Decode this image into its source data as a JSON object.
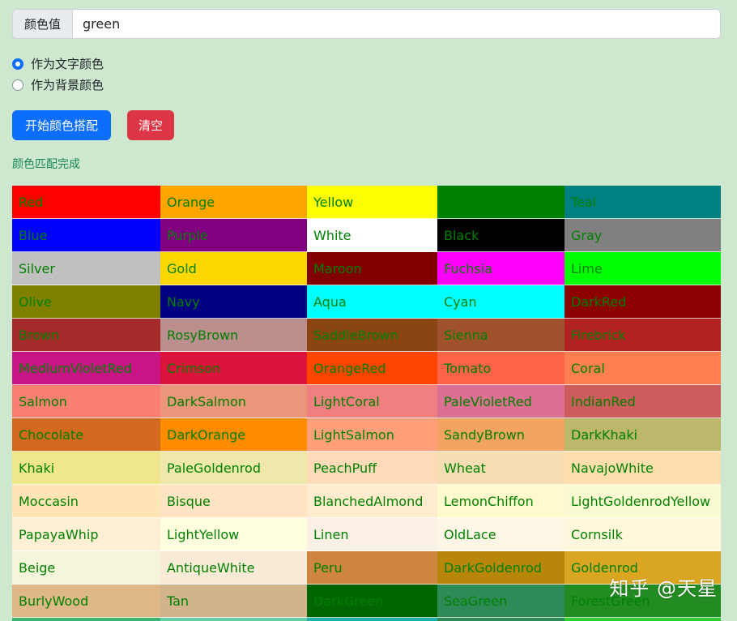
{
  "form": {
    "addon_label": "颜色值",
    "input_value": "green",
    "radio_text_color_label": "作为文字颜色",
    "radio_bg_color_label": "作为背景颜色",
    "selected_option": "作为文字颜色",
    "start_button": "开始颜色搭配",
    "clear_button": "清空",
    "status": "颜色匹配完成"
  },
  "colors": {
    "primary": "#0d6efd",
    "danger": "#dc3545",
    "success_text": "#198754",
    "cell_text": "#008000",
    "page_bg": "#cde8cf"
  },
  "swatches": [
    {
      "name": "Red",
      "bg": "#ff0000"
    },
    {
      "name": "Orange",
      "bg": "#ffa500"
    },
    {
      "name": "Yellow",
      "bg": "#ffff00"
    },
    {
      "name": "",
      "bg": "#008000"
    },
    {
      "name": "Teal",
      "bg": "#008080"
    },
    {
      "name": "Blue",
      "bg": "#0000ff"
    },
    {
      "name": "Purple",
      "bg": "#800080"
    },
    {
      "name": "White",
      "bg": "#ffffff"
    },
    {
      "name": "Black",
      "bg": "#000000"
    },
    {
      "name": "Gray",
      "bg": "#808080"
    },
    {
      "name": "Silver",
      "bg": "#c0c0c0"
    },
    {
      "name": "Gold",
      "bg": "#ffd700"
    },
    {
      "name": "Maroon",
      "bg": "#800000"
    },
    {
      "name": "Fuchsia",
      "bg": "#ff00ff"
    },
    {
      "name": "Lime",
      "bg": "#00ff00"
    },
    {
      "name": "Olive",
      "bg": "#808000"
    },
    {
      "name": "Navy",
      "bg": "#000080"
    },
    {
      "name": "Aqua",
      "bg": "#00ffff"
    },
    {
      "name": "Cyan",
      "bg": "#00ffff"
    },
    {
      "name": "DarkRed",
      "bg": "#8b0000"
    },
    {
      "name": "Brown",
      "bg": "#a52a2a"
    },
    {
      "name": "RosyBrown",
      "bg": "#bc8f8f"
    },
    {
      "name": "SaddleBrown",
      "bg": "#8b4513"
    },
    {
      "name": "Sienna",
      "bg": "#a0522d"
    },
    {
      "name": "Firebrick",
      "bg": "#b22222"
    },
    {
      "name": "MediumVioletRed",
      "bg": "#c71585"
    },
    {
      "name": "Crimson",
      "bg": "#dc143c"
    },
    {
      "name": "OrangeRed",
      "bg": "#ff4500"
    },
    {
      "name": "Tomato",
      "bg": "#ff6347"
    },
    {
      "name": "Coral",
      "bg": "#ff7f50"
    },
    {
      "name": "Salmon",
      "bg": "#fa8072"
    },
    {
      "name": "DarkSalmon",
      "bg": "#e9967a"
    },
    {
      "name": "LightCoral",
      "bg": "#f08080"
    },
    {
      "name": "PaleVioletRed",
      "bg": "#db7093"
    },
    {
      "name": "IndianRed",
      "bg": "#cd5c5c"
    },
    {
      "name": "Chocolate",
      "bg": "#d2691e"
    },
    {
      "name": "DarkOrange",
      "bg": "#ff8c00"
    },
    {
      "name": "LightSalmon",
      "bg": "#ffa07a"
    },
    {
      "name": "SandyBrown",
      "bg": "#f4a460"
    },
    {
      "name": "DarkKhaki",
      "bg": "#bdb76b"
    },
    {
      "name": "Khaki",
      "bg": "#f0e68c"
    },
    {
      "name": "PaleGoldenrod",
      "bg": "#eee8aa"
    },
    {
      "name": "PeachPuff",
      "bg": "#ffdab9"
    },
    {
      "name": "Wheat",
      "bg": "#f5deb3"
    },
    {
      "name": "NavajoWhite",
      "bg": "#ffdead"
    },
    {
      "name": "Moccasin",
      "bg": "#ffe4b5"
    },
    {
      "name": "Bisque",
      "bg": "#ffe4c4"
    },
    {
      "name": "BlanchedAlmond",
      "bg": "#ffebcd"
    },
    {
      "name": "LemonChiffon",
      "bg": "#fffacd"
    },
    {
      "name": "LightGoldenrodYellow",
      "bg": "#fafad2"
    },
    {
      "name": "PapayaWhip",
      "bg": "#ffefd5"
    },
    {
      "name": "LightYellow",
      "bg": "#ffffe0"
    },
    {
      "name": "Linen",
      "bg": "#faf0e6"
    },
    {
      "name": "OldLace",
      "bg": "#fdf5e6"
    },
    {
      "name": "Cornsilk",
      "bg": "#fff8dc"
    },
    {
      "name": "Beige",
      "bg": "#f5f5dc"
    },
    {
      "name": "AntiqueWhite",
      "bg": "#faebd7"
    },
    {
      "name": "Peru",
      "bg": "#cd853f"
    },
    {
      "name": "DarkGoldenrod",
      "bg": "#b8860b"
    },
    {
      "name": "Goldenrod",
      "bg": "#daa520"
    },
    {
      "name": "BurlyWood",
      "bg": "#deb887"
    },
    {
      "name": "Tan",
      "bg": "#d2b48c"
    },
    {
      "name": "DarkGreen",
      "bg": "#006400"
    },
    {
      "name": "SeaGreen",
      "bg": "#2e8b57"
    },
    {
      "name": "ForestGreen",
      "bg": "#228b22"
    },
    {
      "name": "",
      "bg": "#3cb371"
    },
    {
      "name": "",
      "bg": "#66cdaa"
    },
    {
      "name": "",
      "bg": "#20b2aa"
    },
    {
      "name": "",
      "bg": "#2e8b57"
    },
    {
      "name": "",
      "bg": "#32cd32"
    }
  ],
  "watermark": "知乎 @天星"
}
